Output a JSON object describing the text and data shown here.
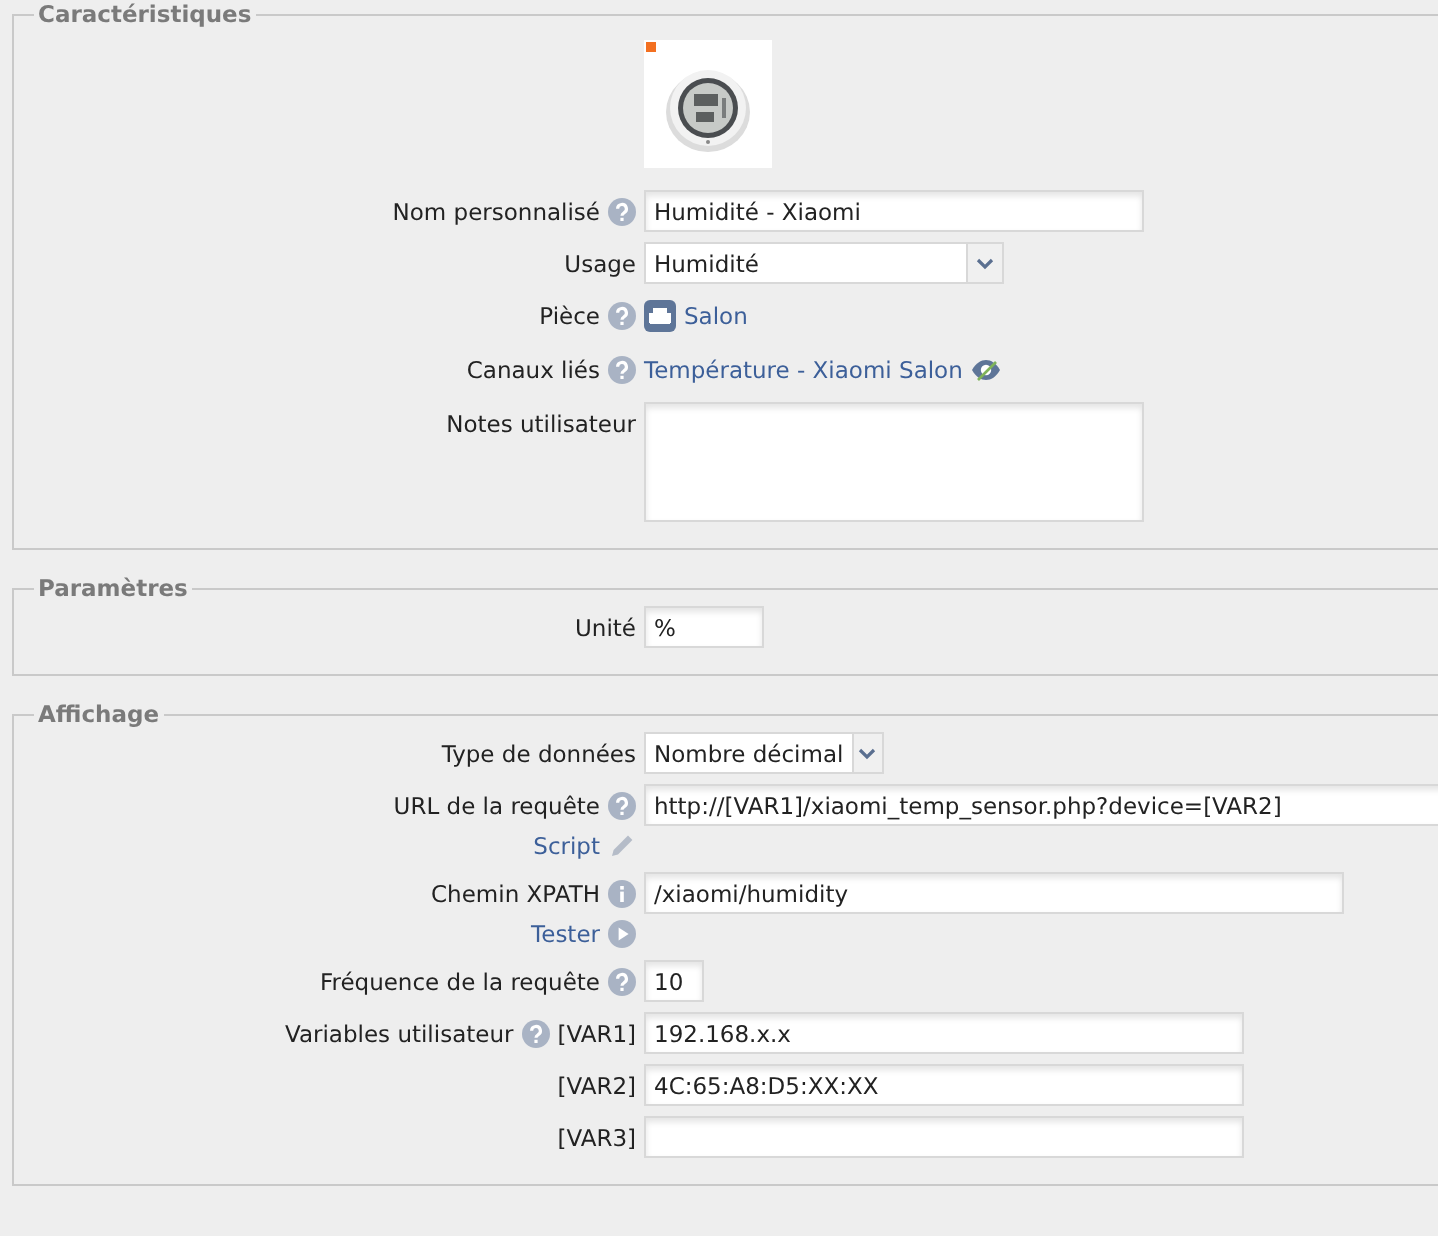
{
  "sections": [
    {
      "legend": "Caractéristiques",
      "rows": [
        {
          "kind": "picture"
        },
        {
          "kind": "text",
          "label": "Nom personnalisé",
          "help": true,
          "value": "Humidité - Xiaomi"
        },
        {
          "kind": "select",
          "label": "Usage",
          "value": "Humidité"
        },
        {
          "kind": "room",
          "label": "Pièce",
          "help": true,
          "value": "Salon"
        },
        {
          "kind": "channel",
          "label": "Canaux liés",
          "help": true,
          "value": "Température - Xiaomi Salon"
        },
        {
          "kind": "textarea",
          "label": "Notes utilisateur"
        }
      ]
    },
    {
      "legend": "Paramètres",
      "rows": [
        {
          "kind": "text",
          "label": "Unité",
          "value": "%"
        }
      ]
    },
    {
      "legend": "Affichage",
      "rows": [
        {
          "kind": "select",
          "label": "Type de données",
          "value": "Nombre décimal"
        },
        {
          "kind": "text",
          "label": "URL de la requête",
          "help": true,
          "value": "http://[VAR1]/xiaomi_temp_sensor.php?device=[VAR2]",
          "action": {
            "label": "Script",
            "kind": "edit"
          }
        },
        {
          "kind": "text",
          "label": "Chemin XPATH",
          "info": true,
          "value": "/xiaomi/humidity",
          "action": {
            "label": "Tester",
            "kind": "run"
          }
        },
        {
          "kind": "text",
          "label": "Fréquence de la requête",
          "help": true,
          "value": "10"
        },
        {
          "kind": "text",
          "label": "Variables utilisateur",
          "help": true,
          "prefix": "[VAR1]",
          "value": "192.168.x.x"
        },
        {
          "kind": "text",
          "prefix": "[VAR2]",
          "value": "4C:65:A8:D5:XX:XX"
        },
        {
          "kind": "text",
          "prefix": "[VAR3]"
        }
      ]
    }
  ]
}
